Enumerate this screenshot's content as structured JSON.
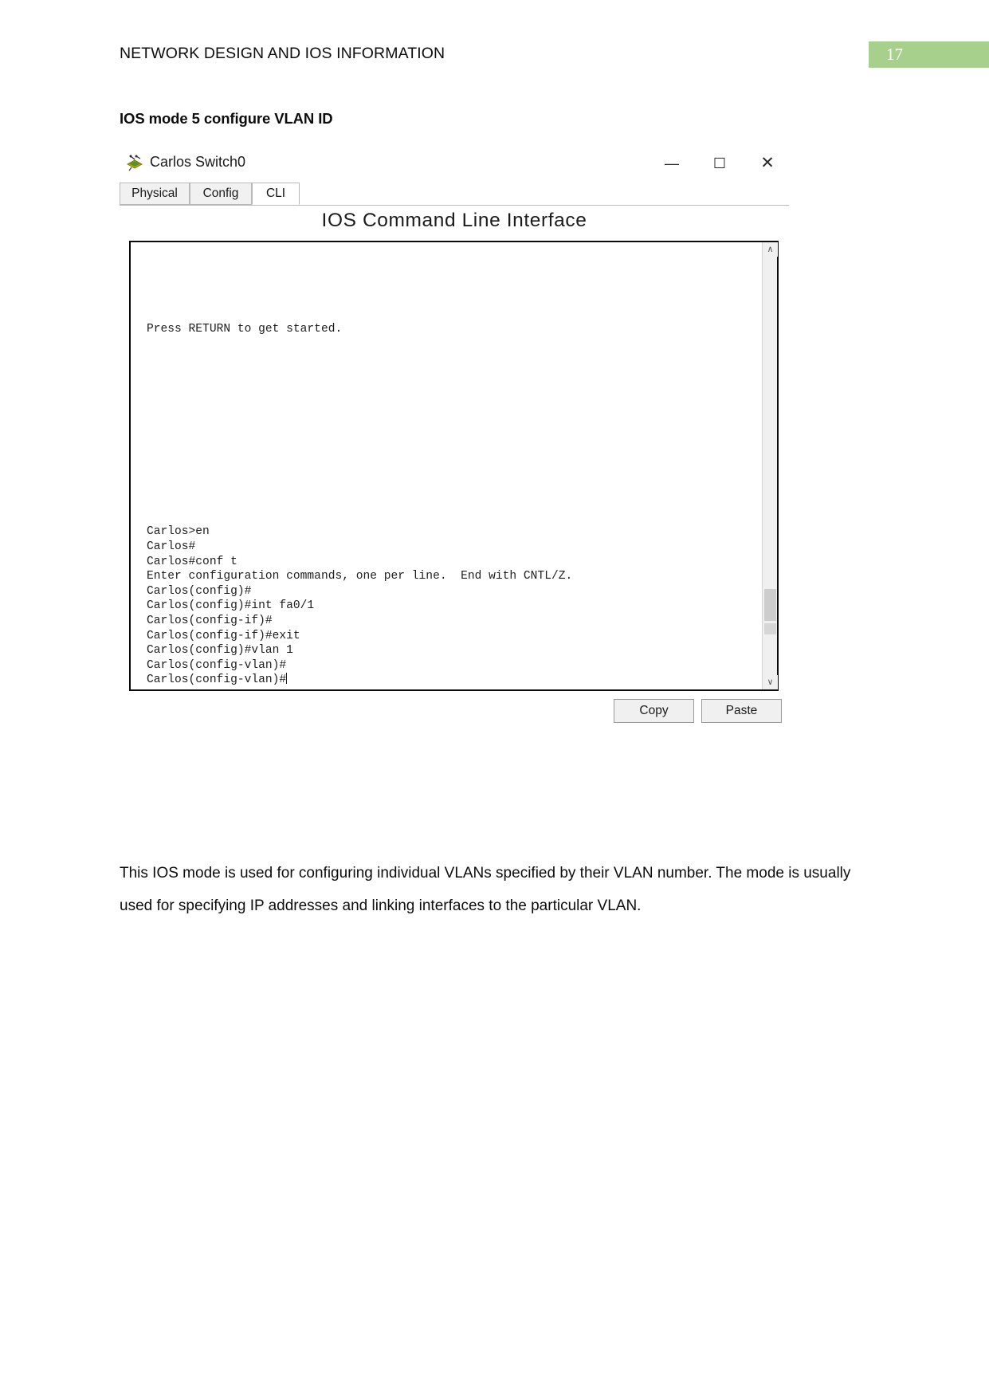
{
  "header": {
    "title": "NETWORK DESIGN AND IOS INFORMATION",
    "page_number": "17",
    "badge_color": "#a8d08d"
  },
  "section": {
    "heading": "IOS mode 5 configure VLAN ID"
  },
  "figure": {
    "window": {
      "title": "Carlos Switch0",
      "icon": "switch-icon",
      "controls": {
        "minimize": "—",
        "maximize": "☐",
        "close": "✕"
      }
    },
    "tabs": [
      {
        "label": "Physical",
        "active": false
      },
      {
        "label": "Config",
        "active": false
      },
      {
        "label": "CLI",
        "active": true
      }
    ],
    "cli_heading": "IOS Command Line Interface",
    "terminal": {
      "top_text": "Press RETURN to get started.",
      "lines": [
        "Carlos>en",
        "Carlos#",
        "Carlos#conf t",
        "Enter configuration commands, one per line.  End with CNTL/Z.",
        "Carlos(config)#",
        "Carlos(config)#int fa0/1",
        "Carlos(config-if)#",
        "Carlos(config-if)#exit",
        "Carlos(config)#vlan 1",
        "Carlos(config-vlan)#",
        "Carlos(config-vlan)#"
      ]
    },
    "scrollbar": {
      "up_arrow": "∧",
      "down_arrow": "∨"
    },
    "buttons": {
      "copy": "Copy",
      "paste": "Paste"
    }
  },
  "body": {
    "paragraph": "This IOS mode is used for configuring individual VLANs specified by their VLAN number. The mode is usually used for specifying IP addresses and linking interfaces to the particular VLAN."
  }
}
